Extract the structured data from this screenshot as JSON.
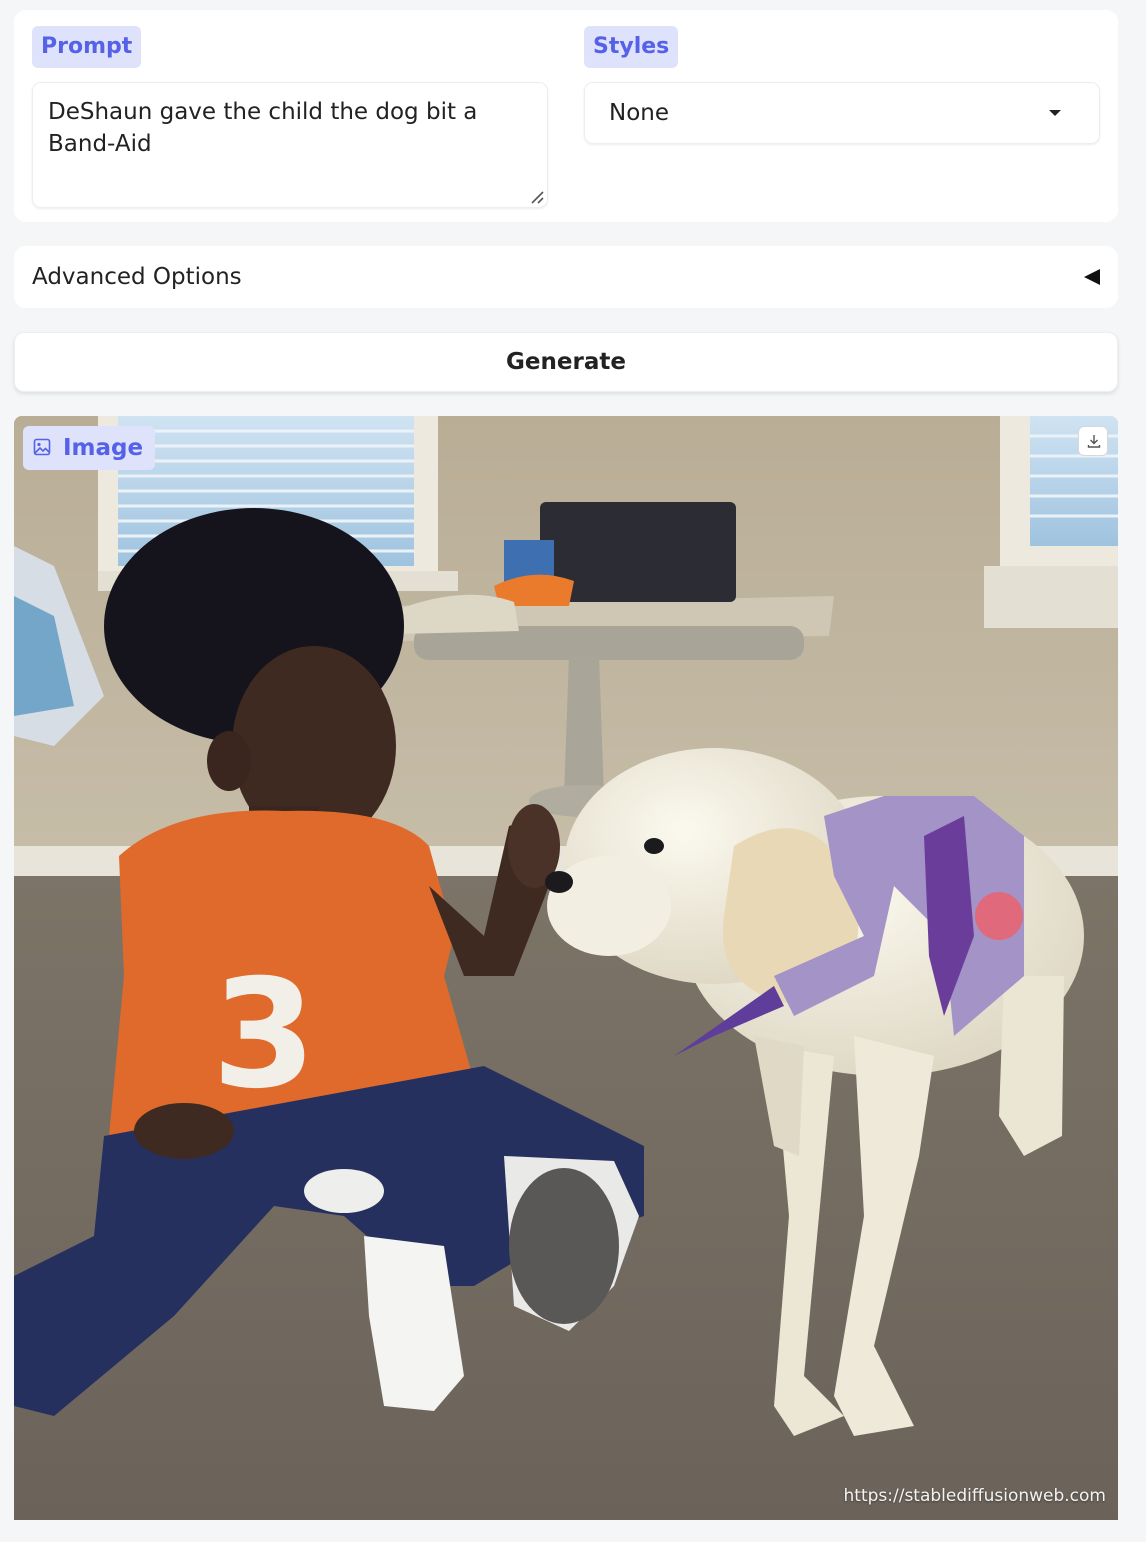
{
  "prompt": {
    "label": "Prompt",
    "value": "DeShaun gave the child the dog bit a Band-Aid"
  },
  "styles": {
    "label": "Styles",
    "selected": "None"
  },
  "advanced": {
    "label": "Advanced Options",
    "state": "collapsed"
  },
  "generate": {
    "label": "Generate"
  },
  "output": {
    "label": "Image",
    "watermark": "https://stablediffusionweb.com"
  },
  "icons": {
    "image_chip": "image-icon",
    "download": "download-icon",
    "dropdown": "caret-down-icon",
    "advanced_toggle": "triangle-left-icon"
  },
  "colors": {
    "accent": "#5561e6",
    "chip_bg": "#dfe2fb",
    "page_bg": "#f5f6f8",
    "panel_bg": "#ffffff"
  }
}
